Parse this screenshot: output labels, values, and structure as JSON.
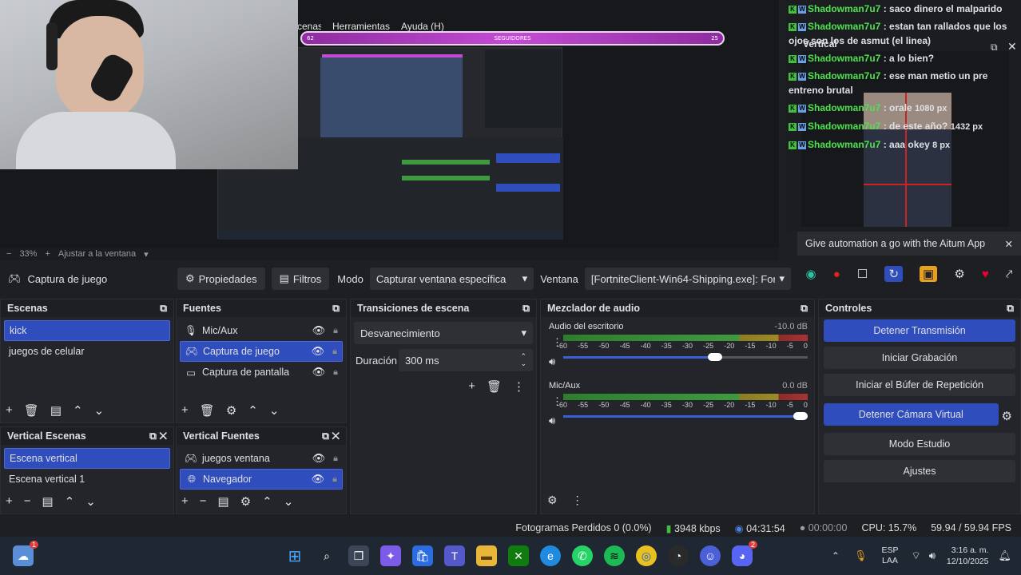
{
  "menu": {
    "items": [
      "cenas",
      "Herramientas",
      "Ayuda (H)"
    ]
  },
  "preview": {
    "follow_bar": {
      "left": "62",
      "center": "SEGUIDORES",
      "right": "25"
    }
  },
  "zoombar": {
    "minus": "−",
    "zoom": "33%",
    "plus": "+",
    "fit": "Ajustar a la ventana"
  },
  "sourcebar": {
    "source_name": "Captura de juego",
    "properties": "Propiedades",
    "filters": "Filtros",
    "mode_label": "Modo",
    "mode_value": "Capturar ventana específica",
    "window_label": "Ventana",
    "window_value": "[FortniteClient-Win64-Shipping.exe]: Fort"
  },
  "scenes": {
    "title": "Escenas",
    "items": [
      "kick",
      "juegos de celular"
    ]
  },
  "sources": {
    "title": "Fuentes",
    "items": [
      "Mic/Aux",
      "Captura de juego",
      "Captura de pantalla"
    ]
  },
  "transitions": {
    "title": "Transiciones de escena",
    "type": "Desvanecimiento",
    "duration_label": "Duración",
    "duration_value": "300 ms"
  },
  "mixer": {
    "title": "Mezclador de audio",
    "tracks": [
      {
        "name": "Audio del escritorio",
        "db": "-10.0 dB",
        "volume": 0.65
      },
      {
        "name": "Mic/Aux",
        "db": "0.0 dB",
        "volume": 1.0
      }
    ],
    "scale": [
      "-60",
      "-55",
      "-50",
      "-45",
      "-40",
      "-35",
      "-30",
      "-25",
      "-20",
      "-15",
      "-10",
      "-5",
      "0"
    ]
  },
  "controls": {
    "title": "Controles",
    "buttons": [
      "Detener Transmisión",
      "Iniciar Grabación",
      "Iniciar el Búfer de Repetición",
      "Detener Cámara Virtual",
      "Modo Estudio",
      "Ajustes"
    ]
  },
  "vscenes": {
    "title": "Vertical Escenas",
    "items": [
      "Escena vertical",
      "Escena vertical 1"
    ]
  },
  "vsources": {
    "title": "Vertical Fuentes",
    "items": [
      "juegos ventana",
      "Navegador"
    ]
  },
  "chat": {
    "messages": [
      {
        "user": "Shadowman7u7",
        "text": ": saco dinero el malparido"
      },
      {
        "user": "Shadowman7u7",
        "text": ": estan tan rallados que los ojos son los de asmut (el linea)"
      },
      {
        "user": "Shadowman7u7",
        "text": ": a lo bien?"
      },
      {
        "user": "Shadowman7u7",
        "text": ": ese man metio un pre entreno brutal"
      },
      {
        "user": "Shadowman7u7",
        "text": ": orale"
      },
      {
        "user": "Shadowman7u7",
        "text": ": de este año?"
      },
      {
        "user": "Shadowman7u7",
        "text": ": aaa okey"
      }
    ],
    "vertical_title": "Vertical",
    "vertical_w": "1080 px",
    "vertical_h": "1432 px",
    "vertical_px": "8 px"
  },
  "aitum": {
    "text": "Give automation a go with the Aitum App"
  },
  "status": {
    "dropped": "Fotogramas Perdidos 0 (0.0%)",
    "bitrate": "3948 kbps",
    "live_time": "04:31:54",
    "rec_time": "00:00:00",
    "cpu": "CPU: 15.7%",
    "fps": "59.94 / 59.94 FPS"
  },
  "taskbar": {
    "lang": "ESP",
    "region": "LAA",
    "time": "3:16 a. m.",
    "date": "12/10/2025",
    "badge_left": "1",
    "badge_discord": "2"
  },
  "colors": {
    "accent": "#2f4dbd",
    "chat_user": "#4ee34e",
    "follow_bar": "#c44bd4"
  }
}
